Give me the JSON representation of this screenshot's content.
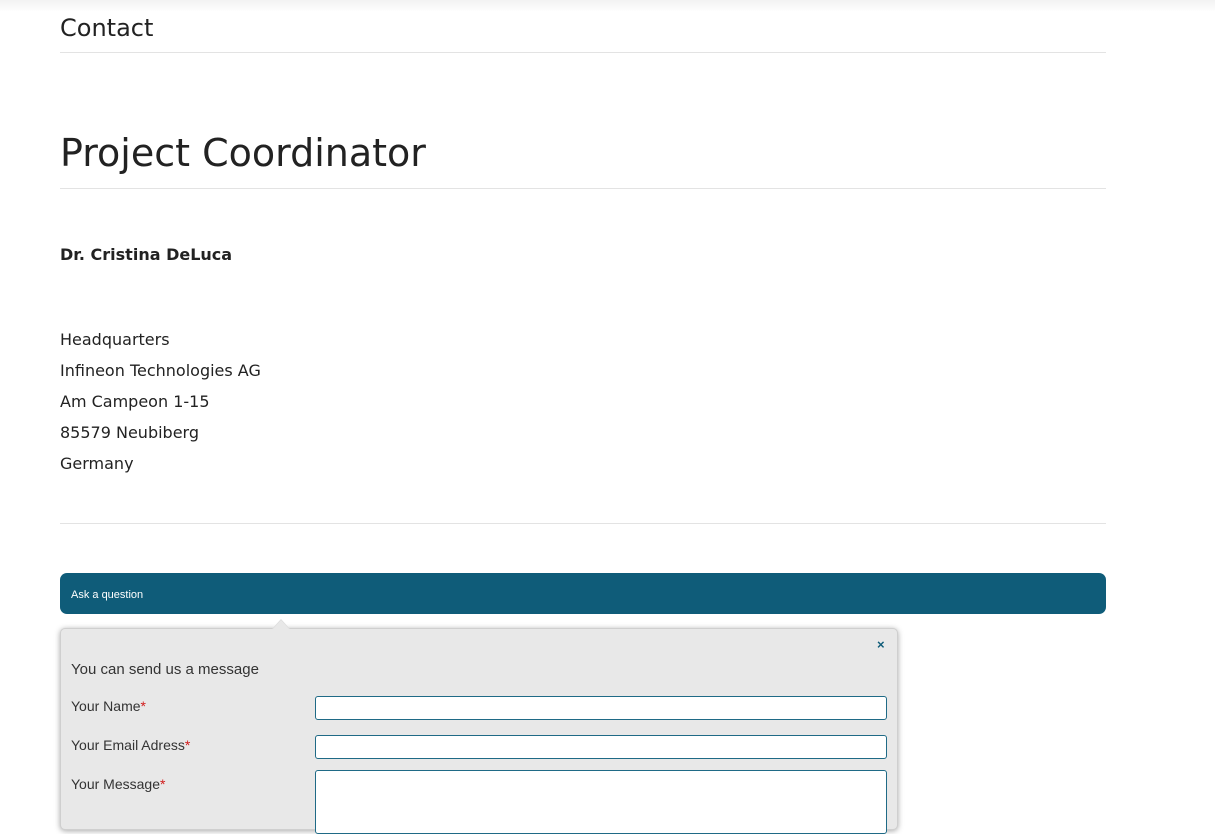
{
  "contact_heading": "Contact",
  "page_title": "Project Coordinator",
  "person_name": "Dr. Cristina DeLuca",
  "address": {
    "line1": "Headquarters",
    "line2": "Infineon Technologies AG",
    "line3": "Am Campeon 1-15",
    "line4": "85579 Neubiberg",
    "line5": "Germany"
  },
  "ask_bar": {
    "label": "Ask a question",
    "color": "#0f5c79"
  },
  "form": {
    "close_glyph": "×",
    "intro": "You can send us a message",
    "required_marker": "*",
    "name_label": "Your Name",
    "name_value": "",
    "email_label": "Your Email Adress",
    "email_value": "",
    "message_label": "Your Message",
    "message_value": ""
  },
  "colors": {
    "accent": "#0f5c79",
    "required": "#d11a1a"
  }
}
